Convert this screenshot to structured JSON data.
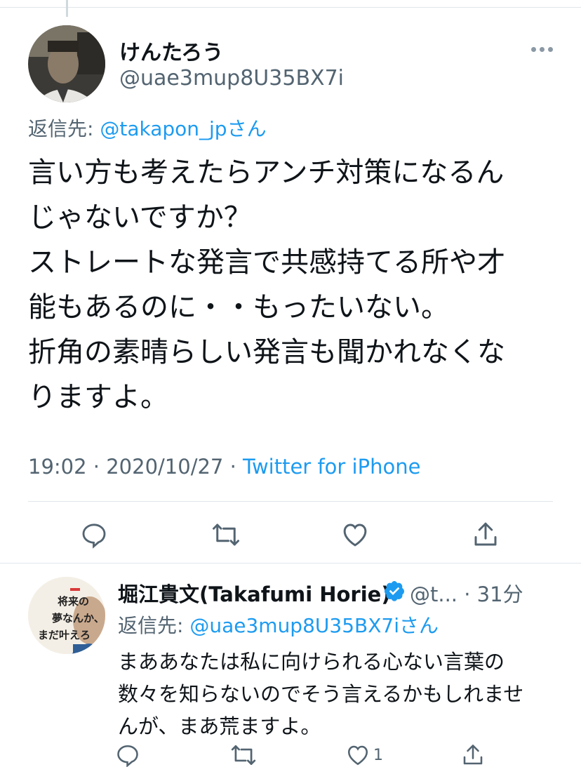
{
  "tweet": {
    "display_name": "けんたろう",
    "handle": "@uae3mup8U35BX7i",
    "reply_prefix": "返信先: ",
    "reply_mention": "@takapon_jpさん",
    "text": "言い方も考えたらアンチ対策になるん\nじゃないですか？\nストレートな発言で共感持てる所や才\n能もあるのに・・もったいない。\n折角の素晴らしい発言も聞かれなくな\nりますよ。",
    "time": "19:02 · 2020/10/27 · ",
    "source": "Twitter for iPhone",
    "icons": [
      "reply-icon",
      "retweet-icon",
      "like-icon",
      "share-icon",
      "more-icon"
    ]
  },
  "reply": {
    "display_name": "堀江貴文(Takafumi Horie)",
    "handle_time": "@t... · 31分",
    "reply_prefix": "返信先: ",
    "reply_mention": "@uae3mup8U35BX7iさん",
    "text": "まああなたは私に向けられる心ない言葉の\n数々を知らないのでそう言えるかもしれませ\nんが、まあ荒ますよ。",
    "like_count": "1",
    "avatar_text": "将来の夢なんか、まだ叶えろ",
    "colors": {
      "accent": "#1d9bf0",
      "muted": "#536471",
      "verified": "#1d9bf0"
    }
  }
}
